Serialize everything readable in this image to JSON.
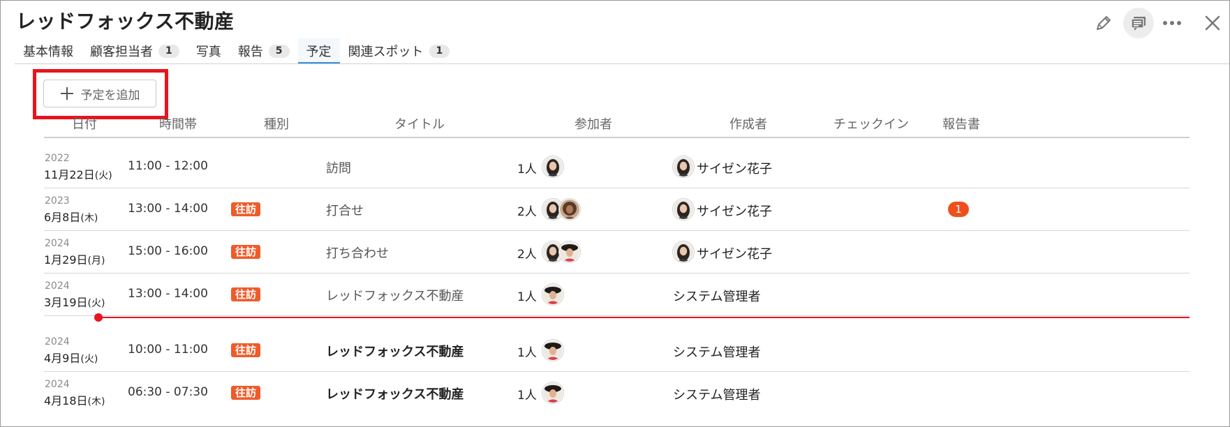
{
  "header": {
    "title": "レッドフォックス不動産"
  },
  "tabs": [
    {
      "label": "基本情報",
      "count": null
    },
    {
      "label": "顧客担当者",
      "count": "1"
    },
    {
      "label": "写真",
      "count": null
    },
    {
      "label": "報告",
      "count": "5"
    },
    {
      "label": "予定",
      "count": null,
      "active": true
    },
    {
      "label": "関連スポット",
      "count": "1"
    }
  ],
  "add_button": {
    "label": "予定を追加",
    "icon": "plus-icon"
  },
  "columns": {
    "date": "日付",
    "time": "時間帯",
    "type": "種別",
    "title": "タイトル",
    "participants": "参加者",
    "creator": "作成者",
    "checkin": "チェックイン",
    "report": "報告書"
  },
  "rows": [
    {
      "year": "2022",
      "md": "11月22日",
      "dow": "(火)",
      "time": "11:00 - 12:00",
      "type": "",
      "title": "訪問",
      "title_bold": false,
      "count": "1人",
      "avatars": [
        "a"
      ],
      "creator": "サイゼン花子",
      "creator_avatar": true,
      "report": ""
    },
    {
      "year": "2023",
      "md": "6月8日",
      "dow": "(木)",
      "time": "13:00 - 14:00",
      "type": "往訪",
      "title": "打合せ",
      "title_bold": false,
      "count": "2人",
      "avatars": [
        "a",
        "b"
      ],
      "creator": "サイゼン花子",
      "creator_avatar": true,
      "report": "1"
    },
    {
      "year": "2024",
      "md": "1月29日",
      "dow": "(月)",
      "time": "15:00 - 16:00",
      "type": "往訪",
      "title": "打ち合わせ",
      "title_bold": false,
      "count": "2人",
      "avatars": [
        "a",
        "c"
      ],
      "creator": "サイゼン花子",
      "creator_avatar": true,
      "report": ""
    },
    {
      "year": "2024",
      "md": "3月19日",
      "dow": "(火)",
      "time": "13:00 - 14:00",
      "type": "往訪",
      "title": "レッドフォックス不動産",
      "title_bold": false,
      "count": "1人",
      "avatars": [
        "c"
      ],
      "creator": "システム管理者",
      "creator_avatar": false,
      "report": ""
    },
    {
      "year": "2024",
      "md": "4月9日",
      "dow": "(火)",
      "time": "10:00 - 11:00",
      "type": "往訪",
      "title": "レッドフォックス不動産",
      "title_bold": true,
      "count": "1人",
      "avatars": [
        "c"
      ],
      "creator": "システム管理者",
      "creator_avatar": false,
      "report": ""
    },
    {
      "year": "2024",
      "md": "4月18日",
      "dow": "(木)",
      "time": "06:30 - 07:30",
      "type": "往訪",
      "title": "レッドフォックス不動産",
      "title_bold": true,
      "count": "1人",
      "avatars": [
        "c"
      ],
      "creator": "システム管理者",
      "creator_avatar": false,
      "report": ""
    }
  ],
  "theme": {
    "accent": "#3d8ed1",
    "type_badge": "#ef5b2a",
    "report_badge": "#ef4f1c",
    "now_line": "#e8141c"
  }
}
